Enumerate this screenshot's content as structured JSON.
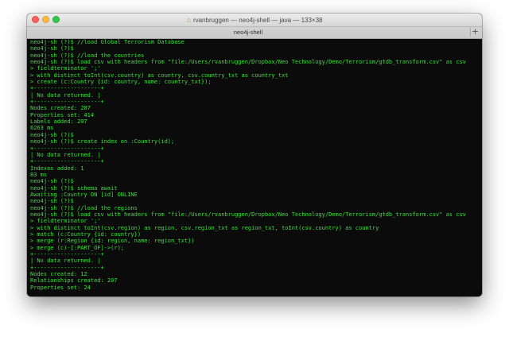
{
  "window": {
    "title": "rvanbruggen — neo4j-shell — java — 133×38",
    "tab_label": "neo4j-shell",
    "new_tab_symbol": "+",
    "colors": {
      "terminal_bg": "#0b0b0b",
      "terminal_fg": "#33e533"
    }
  },
  "terminal": {
    "lines": [
      "neo4j-sh (?)$ //load Global Terrorism Database",
      "neo4j-sh (?)$",
      "neo4j-sh (?)$ //load the countries",
      "neo4j-sh (?)$ load csv with headers from \"file:/Users/rvanbruggen/Dropbox/Neo Technology/Demo/Terrorism/gtdb_transform.csv\" as csv",
      "> fieldterminator ';'",
      "> with distinct toInt(csv.country) as country, csv.country_txt as country_txt",
      "> create (c:Country {id: country, name: country_txt});",
      "+--------------------+",
      "| No data returned. |",
      "+--------------------+",
      "Nodes created: 207",
      "Properties set: 414",
      "Labels added: 207",
      "6263 ms",
      "neo4j-sh (?)$",
      "neo4j-sh (?)$ create index on :Country(id);",
      "+--------------------+",
      "| No data returned. |",
      "+--------------------+",
      "Indexes added: 1",
      "83 ms",
      "neo4j-sh (?)$",
      "neo4j-sh (?)$ schema await",
      "Awaiting :Country ON [id] ONLINE",
      "neo4j-sh (?)$",
      "neo4j-sh (?)$ //load the regions",
      "neo4j-sh (?)$ load csv with headers from \"file:/Users/rvanbruggen/Dropbox/Neo Technology/Demo/Terrorism/gtdb_transform.csv\" as csv",
      "> fieldterminator ';'",
      "> with distinct toInt(csv.region) as region, csv.region_txt as region_txt, toInt(csv.country) as country",
      "> match (c:Country {id: country})",
      "> merge (r:Region {id: region, name: region_txt})",
      "> merge (c)-[:PART_OF]->(r);",
      "+--------------------+",
      "| No data returned. |",
      "+--------------------+",
      "Nodes created: 12",
      "Relationships created: 207",
      "Properties set: 24"
    ]
  }
}
